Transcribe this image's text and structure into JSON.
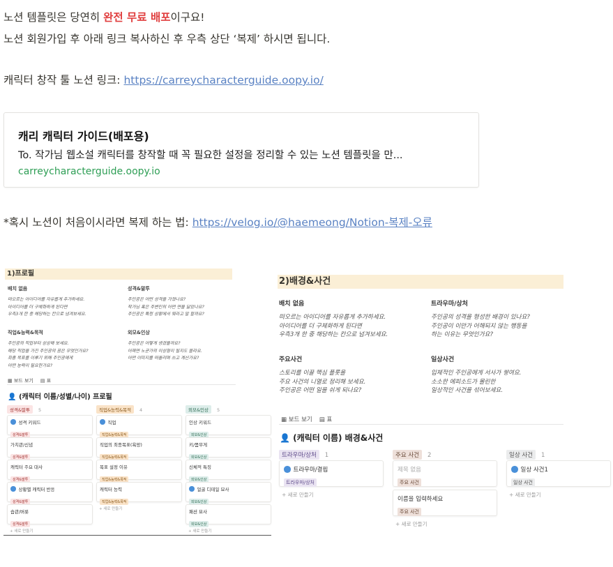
{
  "intro": {
    "line1_before": "노션 템플릿은 당연히 ",
    "line1_highlight": "완전 무료 배포",
    "line1_after": "이구요!",
    "line2": "노션 회원가입 후 아래 링크 복사하신 후 우측 상단 ‘복제’ 하시면 됩니다.",
    "link_label": "캐릭터 창작 툴 노션 링크: ",
    "link_url": "https://carreycharacterguide.oopy.io/"
  },
  "bookmark": {
    "title": "캐리 캐릭터 가이드(배포용)",
    "description": "To. 작가님 웹소설 캐릭터를 창작할 때 꼭 필요한 설정을 정리할 수 있는 노션 템플릿을 만...",
    "domain": "carreycharacterguide.oopy.io"
  },
  "duplicate": {
    "label": "*혹시 노션이 처음이시라면 복제 하는 법: ",
    "url": "https://velog.io/@haemeong/Notion-복제-오류"
  },
  "profile": {
    "header": "1)프로필",
    "blocks": [
      {
        "title": "배치 없음",
        "lines": [
          "떠오르는 아이디어를 자유롭게 추가하세요.",
          "아이디어를 더 구체화하게 된다면",
          "우측3개 한 중 해당하는 칸으로 넘겨보세요."
        ]
      },
      {
        "title": "성격&말투",
        "lines": [
          "주인공은 어떤 성격을 가졌나요?",
          "작가님 혹은 주변인의 어떤 면을 닮았나요?",
          "주인공은 특정 상황에서 뭐라고 말 할까요?"
        ]
      },
      {
        "title": "직업&능력&목적",
        "lines": [
          "주인공의 직업부터 상상해 보세요.",
          "해당 직업을 가진 주인공의 꿈은 무엇인가요?",
          "최종 목표를 이루기 위해 주인공에게",
          "어떤 능력이 필요한가요?"
        ]
      },
      {
        "title": "외모&인상",
        "lines": [
          "주인공은 어떻게 생겼을까요?",
          "어쩌면 노균가의 이상형이 될지도 몰라요.",
          "어떤 이미지를 떠올리며 쓰고 계신가요?"
        ]
      }
    ],
    "tabs": [
      "보드 보기",
      "표"
    ],
    "db_title": "(캐릭터 이름/성별/나이) 프로필",
    "groups": [
      {
        "name": "성격&말투",
        "count": "5",
        "cards": [
          {
            "title": "성격 키워드",
            "tag": "성격&말투"
          },
          {
            "title": "가치관/신념",
            "tag": "성격&말투"
          },
          {
            "title": "캐릭터 주요 대사",
            "tag": "성격&말투"
          },
          {
            "title": "상황별 캐릭터 반응",
            "tag": "성격&말투"
          },
          {
            "title": "습관/버릇",
            "tag": "성격&말투"
          }
        ]
      },
      {
        "name": "직업&능력&목적",
        "count": "4",
        "cards": [
          {
            "title": "직업",
            "tag": "직업&능력&목적"
          },
          {
            "title": "직업의 최종목표(욕망)",
            "tag": "직업&능력&목적"
          },
          {
            "title": "목표 설정 이유",
            "tag": "직업&능력&목적"
          },
          {
            "title": "캐릭터 능력",
            "tag": "직업&능력&목적"
          }
        ]
      },
      {
        "name": "외모&인상",
        "count": "5",
        "cards": [
          {
            "title": "인상 키워드",
            "tag": "외모&인상"
          },
          {
            "title": "키/몸무게",
            "tag": "외모&인상"
          },
          {
            "title": "신체적 특징",
            "tag": "외모&인상"
          },
          {
            "title": "얼굴 디테일 묘사",
            "tag": "외모&인상"
          },
          {
            "title": "패션 묘사",
            "tag": "외모&인상"
          }
        ]
      }
    ],
    "add_label": "+ 새로 만들기"
  },
  "background": {
    "header": "2)배경&사건",
    "blocks": [
      {
        "title": "배치 없음",
        "lines": [
          "떠오르는 아이디어를 자유롭게 추가하세요.",
          "아이디어를 더 구체화하게 된다면",
          "우측3개 한 중 해당하는 칸으로 넘겨보세요."
        ]
      },
      {
        "title": "트라우마/상처",
        "lines": [
          "주인공의 성격을 형성한 배경이 있나요?",
          "주인공이 이만가 어해되지 않는 행동을",
          "하는 이유는 무엇인가요?"
        ]
      },
      {
        "title": "주요사건",
        "lines": [
          "스토리를 이끌 핵심 플롯을",
          "주요 사건의 니열로 정리해 보세요.",
          "주인공은 어떤 일을 쉬게 되나요?"
        ]
      },
      {
        "title": "일상사건",
        "lines": [
          "입체적인 주인공에게 서사가 쌓여요.",
          "소소한 에피소드가 몰린한",
          "일상적인 사건을 섞어보세요."
        ]
      }
    ],
    "tabs": [
      "보드 보기",
      "표"
    ],
    "db_title": "(캐릭터 이름) 배경&사건",
    "groups": [
      {
        "name": "트라우마/상처",
        "count": "1",
        "cards": [
          {
            "title": "트라우마/결핍",
            "tag": "트라우마/상처"
          }
        ]
      },
      {
        "name": "주요 사건",
        "count": "2",
        "cards": [
          {
            "title": "제목 없음",
            "tag": "주요 사건"
          },
          {
            "title": "이름을 입력하세요",
            "tag": "주요 사건"
          }
        ]
      },
      {
        "name": "일상 사건",
        "count": "1",
        "cards": [
          {
            "title": "일상 사건1",
            "tag": "일상 사건"
          }
        ]
      }
    ],
    "add_label": "+ 새로 만들기"
  },
  "colors": {
    "highlight": "#e03e3e",
    "link": "#5a82c3",
    "domain": "#2e9e55",
    "header_bg": "#fbefd6"
  }
}
